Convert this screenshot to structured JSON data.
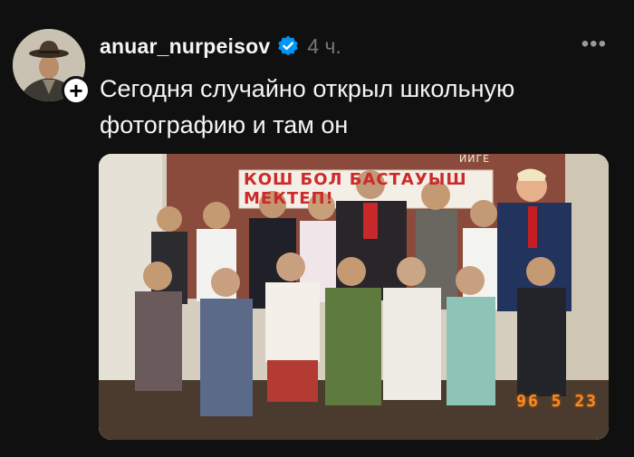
{
  "post": {
    "username": "anuar_nurpeisov",
    "time": "4 ч.",
    "text": "Сегодня случайно открыл школьную фотографию и там он",
    "more_icon": "more-horizontal-icon",
    "verified_icon": "verified-badge-icon",
    "follow_icon": "plus-icon",
    "photo": {
      "banner": "КОШ БОЛ БАСТАУЫШ МЕКТЕП!",
      "wall_text": "ЙИГЕ",
      "date_stamp": "96 5 23"
    }
  },
  "colors": {
    "background": "#101010",
    "text": "#f3f5f7",
    "muted": "#777777",
    "verified": "#0095f6",
    "date_stamp": "#ff8a1e",
    "banner_text": "#cc2a2a"
  }
}
